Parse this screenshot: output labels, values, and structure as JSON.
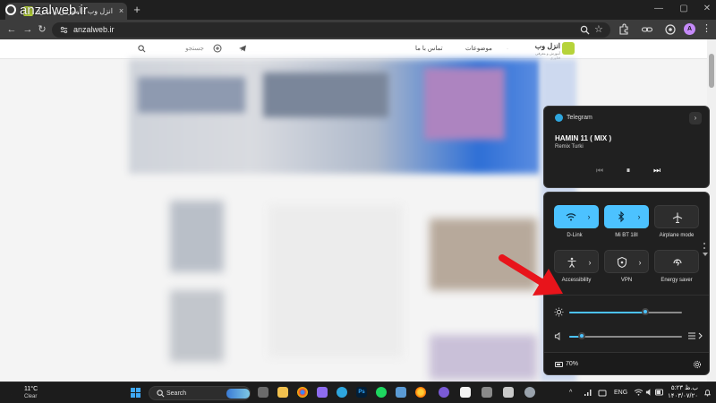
{
  "browser": {
    "tab_title": "انزل وب - آموزش و معرفی فناوری",
    "tab_close": "×",
    "new_tab": "+",
    "url": "anzalweb.ir",
    "window_buttons": [
      "—",
      "▢",
      "✕"
    ],
    "profile_initial": "A",
    "menu_glyph": "⋮"
  },
  "watermark": {
    "text": "anzalweb.ir"
  },
  "site": {
    "logo_name": "انزل وب",
    "logo_tagline": "آموزش و معرفی فناوری",
    "nav": [
      "موضوعات",
      "تماس با ما"
    ],
    "search_placeholder": "جستجو"
  },
  "media": {
    "app": "Telegram",
    "track": "HAMIN 11 ( MIX )",
    "artist": "Remix Turki",
    "expand_glyph": "›",
    "prev_glyph": "⏮",
    "play_glyph": "⏸",
    "next_glyph": "⏭"
  },
  "quick_settings": {
    "tiles": [
      {
        "label": "D-Link",
        "icon": "wifi-icon",
        "on": true,
        "has_arrow": true
      },
      {
        "label": "Mi BT 18I",
        "icon": "bluetooth-icon",
        "on": true,
        "has_arrow": true
      },
      {
        "label": "Airplane mode",
        "icon": "airplane-icon",
        "on": false,
        "has_arrow": false
      },
      {
        "label": "Accessibility",
        "icon": "accessibility-icon",
        "on": false,
        "has_arrow": true
      },
      {
        "label": "VPN",
        "icon": "vpn-shield-icon",
        "on": false,
        "has_arrow": true
      },
      {
        "label": "Energy saver",
        "icon": "energy-saver-icon",
        "on": false,
        "has_arrow": false
      }
    ],
    "tile_arrow": "›",
    "brightness_level": 0.68,
    "volume_level": 0.12,
    "battery": "70%",
    "accent": "#4cc2ff"
  },
  "taskbar": {
    "temperature": "11°C",
    "condition": "Clear",
    "search_label": "Search",
    "language": "ENG",
    "time": "۵:۲۳ ب.ظ",
    "date": "۱۴۰۳/۰۷/۲۰",
    "chevron": "^"
  },
  "annotation": {
    "arrow_color": "#e8141b"
  }
}
